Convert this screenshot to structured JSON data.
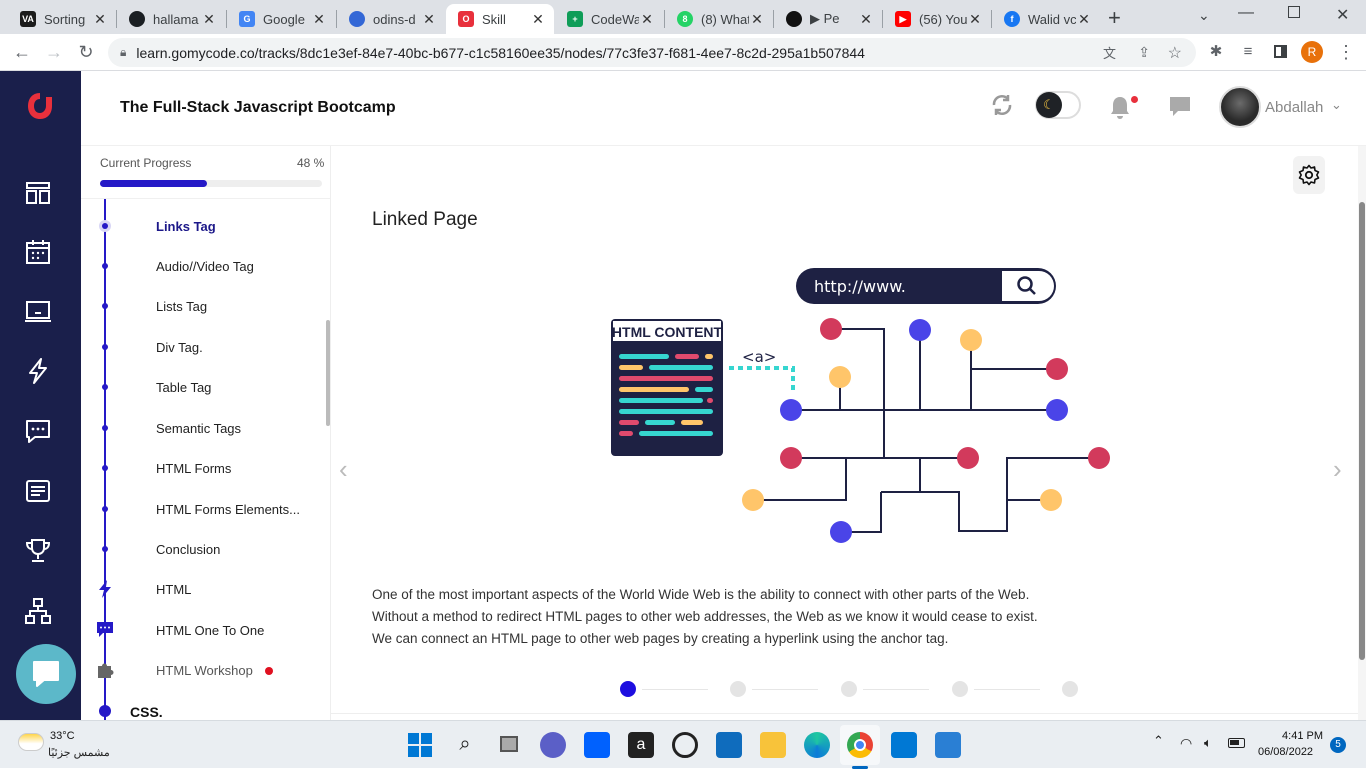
{
  "browser": {
    "tabs": [
      {
        "label": "Sorting",
        "icon": "va-icon",
        "color": "#1b1b1b"
      },
      {
        "label": "hallama",
        "icon": "github-icon",
        "color": "#1b1f23"
      },
      {
        "label": "Google",
        "icon": "google-translate-icon",
        "color": "#4285f4"
      },
      {
        "label": "odins-d",
        "icon": "odin-icon",
        "color": "#3367d6"
      },
      {
        "label": "Skill",
        "icon": "gomycode-icon",
        "color": "#e8303c"
      },
      {
        "label": "CodeWa",
        "icon": "sheets-icon",
        "color": "#0f9d58"
      },
      {
        "label": "(8) What",
        "icon": "whatsapp-icon",
        "color": "#25d366"
      },
      {
        "label": "▶ Pe",
        "icon": "media-icon",
        "color": "#111111"
      },
      {
        "label": "(56) You",
        "icon": "youtube-icon",
        "color": "#ff0000"
      },
      {
        "label": "Walid vc",
        "icon": "facebook-icon",
        "color": "#1877f2"
      }
    ],
    "url": "learn.gomycode.co/tracks/8dc1e3ef-84e7-40bc-b677-c1c58160ee35/nodes/77c3fe37-f681-4ee7-8c2d-295a1b507844",
    "profile_initial": "R"
  },
  "header": {
    "course_title": "The Full-Stack Javascript Bootcamp",
    "username": "Abdallah",
    "accent": "#e8303c"
  },
  "sidebar": {
    "progress_label": "Current Progress",
    "progress_value": "48 %",
    "progress_fraction": 0.48,
    "lessons": [
      {
        "label": "Links Tag",
        "active": true
      },
      {
        "label": "Audio//Video Tag"
      },
      {
        "label": "Lists Tag"
      },
      {
        "label": "Div Tag."
      },
      {
        "label": "Table Tag"
      },
      {
        "label": "Semantic Tags"
      },
      {
        "label": "HTML Forms"
      },
      {
        "label": "HTML Forms Elements..."
      },
      {
        "label": "Conclusion"
      },
      {
        "label": "HTML",
        "icon": "lightning-icon"
      },
      {
        "label": "HTML One To One",
        "icon": "chat-icon"
      },
      {
        "label": "HTML Workshop",
        "icon": "puzzle-icon"
      }
    ],
    "section": "CSS."
  },
  "content": {
    "title": "Linked Page",
    "illustration": {
      "search_text": "http://www.",
      "card_title": "HTML CONTENT",
      "tag": "<a>"
    },
    "paragraph": [
      "One of the most important aspects of the World Wide Web is the ability to connect with other parts of the Web.",
      "Without a method to redirect HTML pages to other web addresses, the Web as we know it would cease to exist.",
      "We can connect an HTML page to other web pages by creating a hyperlink using the anchor tag."
    ],
    "slides_total": 5,
    "slide_current": 1
  },
  "taskbar": {
    "weather_temp": "33°C",
    "weather_desc": "مشمس جزئيًا",
    "time": "4:41 PM",
    "date": "06/08/2022",
    "notifications": "5"
  }
}
